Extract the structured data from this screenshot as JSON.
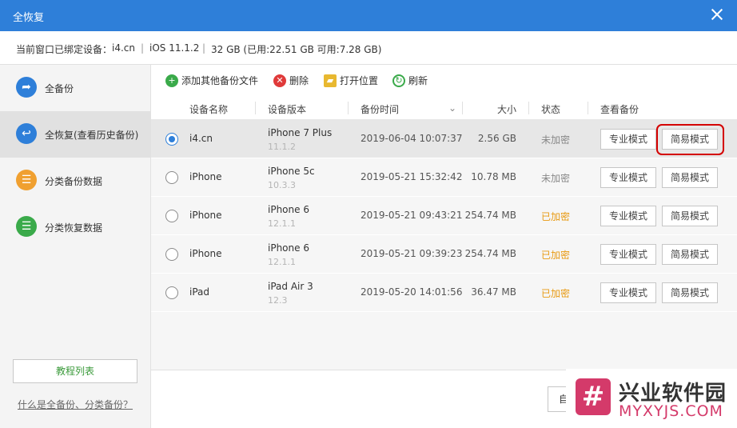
{
  "window": {
    "title": "全恢复"
  },
  "device_bar": {
    "label": "当前窗口已绑定设备：",
    "device": "i4.cn",
    "sep1": "|",
    "ios": "iOS 11.1.2",
    "sep2": "|",
    "storage": "32 GB (已用:22.51 GB 可用:7.28 GB)"
  },
  "sidebar": {
    "items": [
      {
        "label": "全备份",
        "icon": "arrow-share-icon",
        "color": "#2e7fd9"
      },
      {
        "label": "全恢复(查看历史备份)",
        "icon": "arrow-back-icon",
        "color": "#2e7fd9"
      },
      {
        "label": "分类备份数据",
        "icon": "category-backup-icon",
        "color": "#f0a030"
      },
      {
        "label": "分类恢复数据",
        "icon": "category-restore-icon",
        "color": "#3aaa4a"
      }
    ],
    "tutorial_label": "教程列表",
    "help_link": "什么是全备份、分类备份？"
  },
  "toolbar": {
    "add": "添加其他备份文件",
    "delete": "删除",
    "open": "打开位置",
    "refresh": "刷新"
  },
  "table": {
    "headers": {
      "name": "设备名称",
      "version": "设备版本",
      "time": "备份时间",
      "size": "大小",
      "status": "状态",
      "view": "查看备份"
    },
    "rows": [
      {
        "name": "i4.cn",
        "model": "iPhone 7 Plus",
        "ios": "11.1.2",
        "time": "2019-06-04 10:07:37",
        "size": "2.56 GB",
        "status": "未加密",
        "encrypted": false,
        "selected": true
      },
      {
        "name": "iPhone",
        "model": "iPhone 5c",
        "ios": "10.3.3",
        "time": "2019-05-21 15:32:42",
        "size": "10.78 MB",
        "status": "未加密",
        "encrypted": false,
        "selected": false
      },
      {
        "name": "iPhone",
        "model": "iPhone 6",
        "ios": "12.1.1",
        "time": "2019-05-21 09:43:21",
        "size": "254.74 MB",
        "status": "已加密",
        "encrypted": true,
        "selected": false
      },
      {
        "name": "iPhone",
        "model": "iPhone 6",
        "ios": "12.1.1",
        "time": "2019-05-21 09:39:23",
        "size": "254.74 MB",
        "status": "已加密",
        "encrypted": true,
        "selected": false
      },
      {
        "name": "iPad",
        "model": "iPad Air 3",
        "ios": "12.3",
        "time": "2019-05-20 14:01:56",
        "size": "36.47 MB",
        "status": "已加密",
        "encrypted": true,
        "selected": false
      }
    ],
    "pro_label": "专业模式",
    "easy_label": "简易模式"
  },
  "footer": {
    "button_label": "自"
  },
  "watermark": {
    "logo": "#",
    "cn": "兴业软件园",
    "en": "MYXYJS.COM"
  }
}
